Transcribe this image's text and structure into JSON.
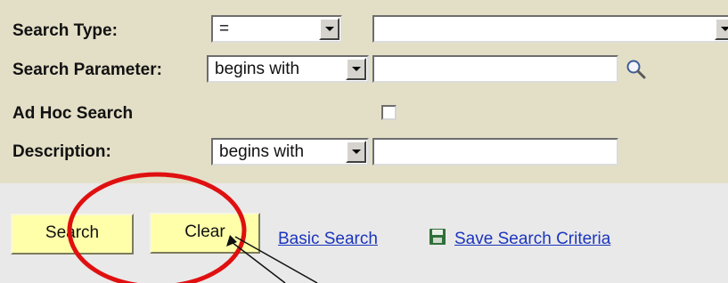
{
  "search_form": {
    "search_type": {
      "label": "Search Type:",
      "operator": "=",
      "value": ""
    },
    "search_parameter": {
      "label": "Search Parameter:",
      "operator": "begins with",
      "value": ""
    },
    "ad_hoc_search": {
      "label": "Ad Hoc Search",
      "checked": false
    },
    "description": {
      "label": "Description:",
      "operator": "begins with",
      "value": ""
    }
  },
  "actions": {
    "search_label": "Search",
    "clear_label": "Clear",
    "basic_search_label": "Basic Search",
    "save_criteria_label": "Save Search Criteria"
  },
  "annotation": {
    "color": "#e01010"
  }
}
